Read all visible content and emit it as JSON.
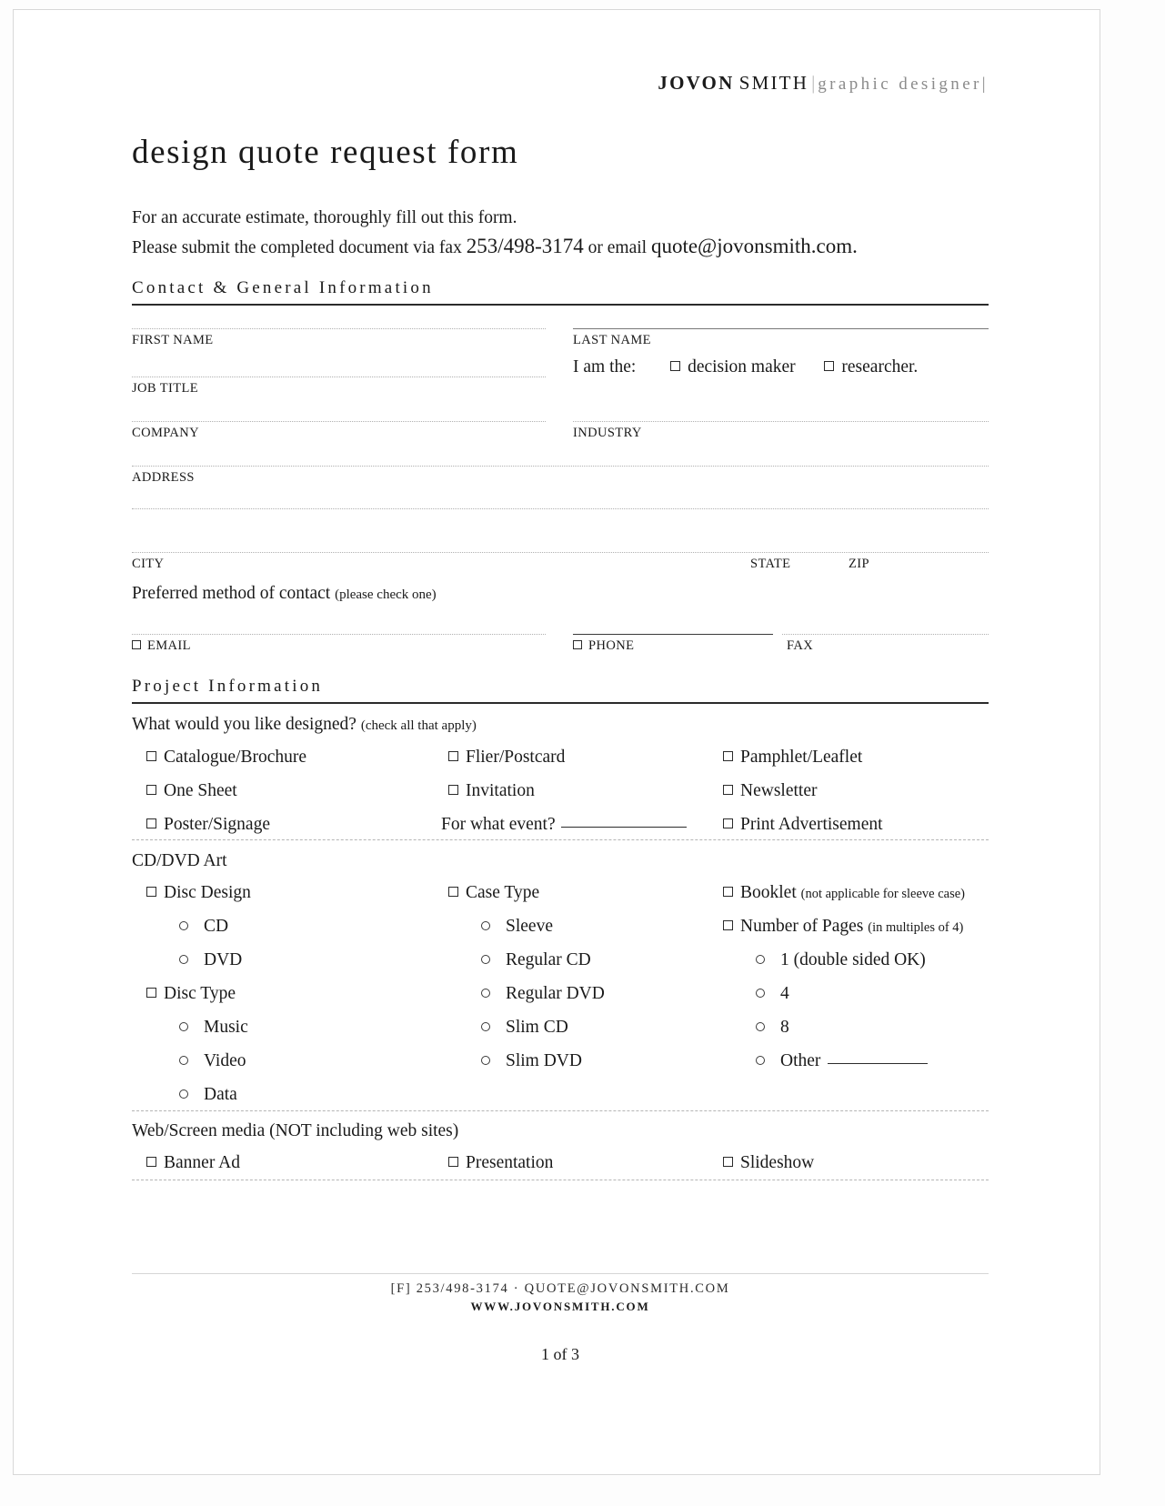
{
  "brand": {
    "first_name": "JOVON",
    "last_name": "SMITH",
    "separator": "|",
    "role": "graphic designer",
    "role_close": "|"
  },
  "document": {
    "title": "design quote request form",
    "intro_line1": "For an accurate estimate, thoroughly fill out this form.",
    "intro_line2_pre": "Please submit the completed document via fax ",
    "intro_fax": "253/498-3174",
    "intro_line2_mid": " or email ",
    "intro_email": "quote@jovonsmith.com."
  },
  "sections": {
    "contact": {
      "heading": "Contact & General Information",
      "fields": {
        "first_name": "FIRST NAME",
        "last_name": "LAST NAME",
        "job_title": "JOB TITLE",
        "company": "COMPANY",
        "industry": "INDUSTRY",
        "address": "ADDRESS",
        "city": "CITY",
        "state": "STATE",
        "zip": "ZIP",
        "email": "EMAIL",
        "phone": "PHONE",
        "fax": "FAX"
      },
      "role_question": {
        "prompt": "I am the:",
        "option_decision": "decision maker",
        "option_researcher": "researcher."
      },
      "contact_method": {
        "label": "Preferred method of contact",
        "hint": "(please check one)"
      }
    },
    "project": {
      "heading": "Project Information",
      "designed_question": {
        "label": "What would you like designed?",
        "hint": "(check all that apply)"
      },
      "print_options": [
        {
          "col1": "Catalogue/Brochure",
          "col2": "Flier/Postcard",
          "col3": "Pamphlet/Leaflet"
        },
        {
          "col1": "One Sheet",
          "col2": "Invitation",
          "col3": "Newsletter"
        },
        {
          "col1": "Poster/Signage",
          "col2": "",
          "col3": "Print Advertisement"
        }
      ],
      "event_prompt": "For what event?",
      "cd_dvd": {
        "group_label": "CD/DVD Art",
        "col1": {
          "heading": "Disc Design",
          "items": [
            "CD",
            "DVD"
          ],
          "heading2": "Disc Type",
          "items2": [
            "Music",
            "Video",
            "Data"
          ]
        },
        "col2": {
          "heading": "Case Type",
          "items": [
            "Sleeve",
            "Regular CD",
            "Regular DVD",
            "Slim CD",
            "Slim DVD"
          ]
        },
        "col3": {
          "heading": "Booklet",
          "heading_note": "(not applicable for sleeve case)",
          "heading2": "Number of Pages",
          "heading2_note": "(in multiples of 4)",
          "items2": [
            "1 (double sided OK)",
            "4",
            "8",
            "Other"
          ]
        }
      },
      "web_screen": {
        "group_label": "Web/Screen media (NOT including web sites)",
        "options": [
          "Banner Ad",
          "Presentation",
          "Slideshow"
        ]
      }
    }
  },
  "footer": {
    "line1": "[F] 253/498-3174 · QUOTE@JOVONSMITH.COM",
    "line2": "WWW.JOVONSMITH.COM",
    "page_number": "1 of 3"
  }
}
